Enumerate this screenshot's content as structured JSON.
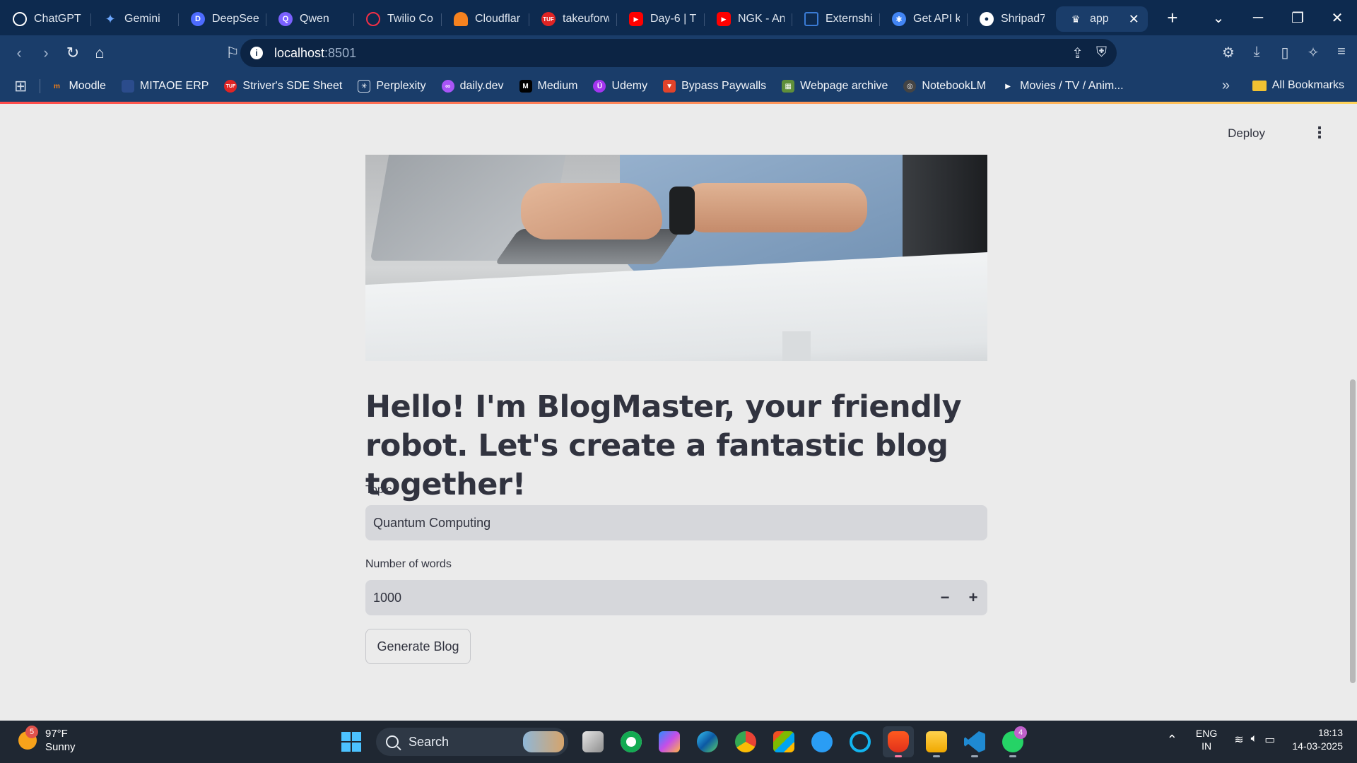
{
  "browser": {
    "tabs": [
      {
        "label": "ChatGPT",
        "icon": "chatgpt-icon",
        "color": "#ffffff"
      },
      {
        "label": "Gemini",
        "icon": "gemini-icon",
        "color": "#6ea8fe"
      },
      {
        "label": "DeepSeek",
        "icon": "deepseek-icon",
        "color": "#4d6bfe"
      },
      {
        "label": "Qwen",
        "icon": "qwen-icon",
        "color": "#7b61ff"
      },
      {
        "label": "Twilio Co",
        "icon": "twilio-icon",
        "color": "#f22f46"
      },
      {
        "label": "Cloudflar",
        "icon": "cloudflare-icon",
        "color": "#f6821f"
      },
      {
        "label": "takeuforw",
        "icon": "tuf-icon",
        "color": "#e02424"
      },
      {
        "label": "Day-6 | T",
        "icon": "youtube-icon",
        "color": "#ff0000"
      },
      {
        "label": "NGK - An",
        "icon": "youtube-icon",
        "color": "#ff0000"
      },
      {
        "label": "Externshi",
        "icon": "externship-icon",
        "color": "#3a7bd5"
      },
      {
        "label": "Get API k",
        "icon": "api-key-icon",
        "color": "#4285f4"
      },
      {
        "label": "Shripad7",
        "icon": "github-icon",
        "color": "#ffffff"
      }
    ],
    "active_tab": {
      "label": "app",
      "icon": "streamlit-icon"
    },
    "address": {
      "host": "localhost",
      "port": ":8501"
    },
    "bookmarks": [
      {
        "label": "Moodle",
        "color": "#f98012"
      },
      {
        "label": "MITAOE ERP",
        "color": "#2b4c8c"
      },
      {
        "label": "Striver's SDE Sheet",
        "color": "#e02424"
      },
      {
        "label": "Perplexity",
        "color": "#20808d"
      },
      {
        "label": "daily.dev",
        "color": "#a855f7"
      },
      {
        "label": "Medium",
        "color": "#000000"
      },
      {
        "label": "Udemy",
        "color": "#a435f0"
      },
      {
        "label": "Bypass Paywalls",
        "color": "#e2432a"
      },
      {
        "label": "Webpage archive",
        "color": "#5f8f3a"
      },
      {
        "label": "NotebookLM",
        "color": "#444444"
      },
      {
        "label": "Movies / TV / Anim...",
        "color": "#ffffff"
      }
    ],
    "all_bookmarks": "All Bookmarks"
  },
  "app": {
    "deploy_label": "Deploy",
    "heading": "Hello! I'm BlogMaster, your friendly robot. Let's create a fantastic blog together!",
    "topic": {
      "label": "Topic",
      "value": "Quantum Computing"
    },
    "words": {
      "label": "Number of words",
      "value": "1000"
    },
    "generate_label": "Generate Blog"
  },
  "taskbar": {
    "weather": {
      "temp": "97°F",
      "condition": "Sunny",
      "badge": "5"
    },
    "search_label": "Search",
    "whatsapp_badge": "4",
    "lang": {
      "line1": "ENG",
      "line2": "IN"
    },
    "time": "18:13",
    "date": "14-03-2025"
  }
}
